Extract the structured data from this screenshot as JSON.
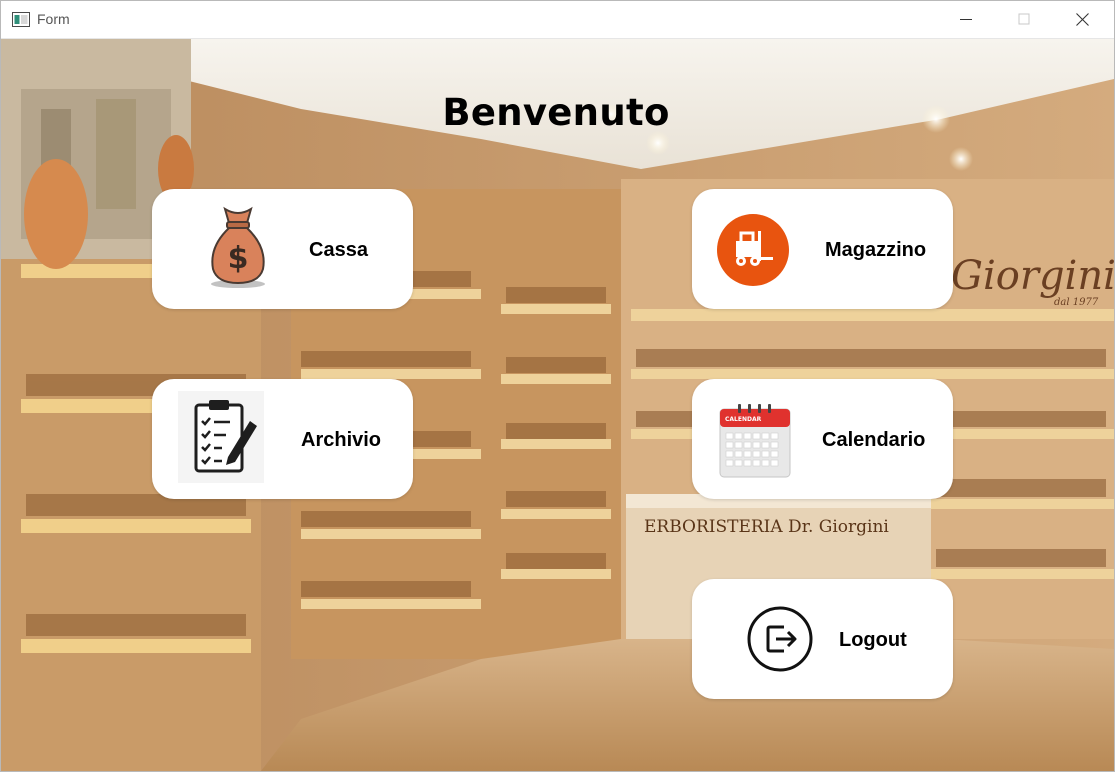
{
  "window": {
    "title": "Form"
  },
  "header": {
    "welcome": "Benvenuto"
  },
  "tiles": {
    "cassa": {
      "label": "Cassa",
      "icon": "money-bag-icon"
    },
    "magazzino": {
      "label": "Magazzino",
      "icon": "forklift-icon"
    },
    "archivio": {
      "label": "Archivio",
      "icon": "clipboard-pencil-icon"
    },
    "calendario": {
      "label": "Calendario",
      "icon": "calendar-icon",
      "icon_caption": "CALENDAR"
    },
    "logout": {
      "label": "Logout",
      "icon": "logout-icon"
    }
  },
  "background": {
    "signs": [
      "Giorgini",
      "dal 1977",
      "ERBORISTERIA Dr. Giorgini"
    ]
  },
  "colors": {
    "accent_orange": "#e8540f",
    "tile_bg": "#ffffff",
    "money_bag": "#d9825b"
  }
}
